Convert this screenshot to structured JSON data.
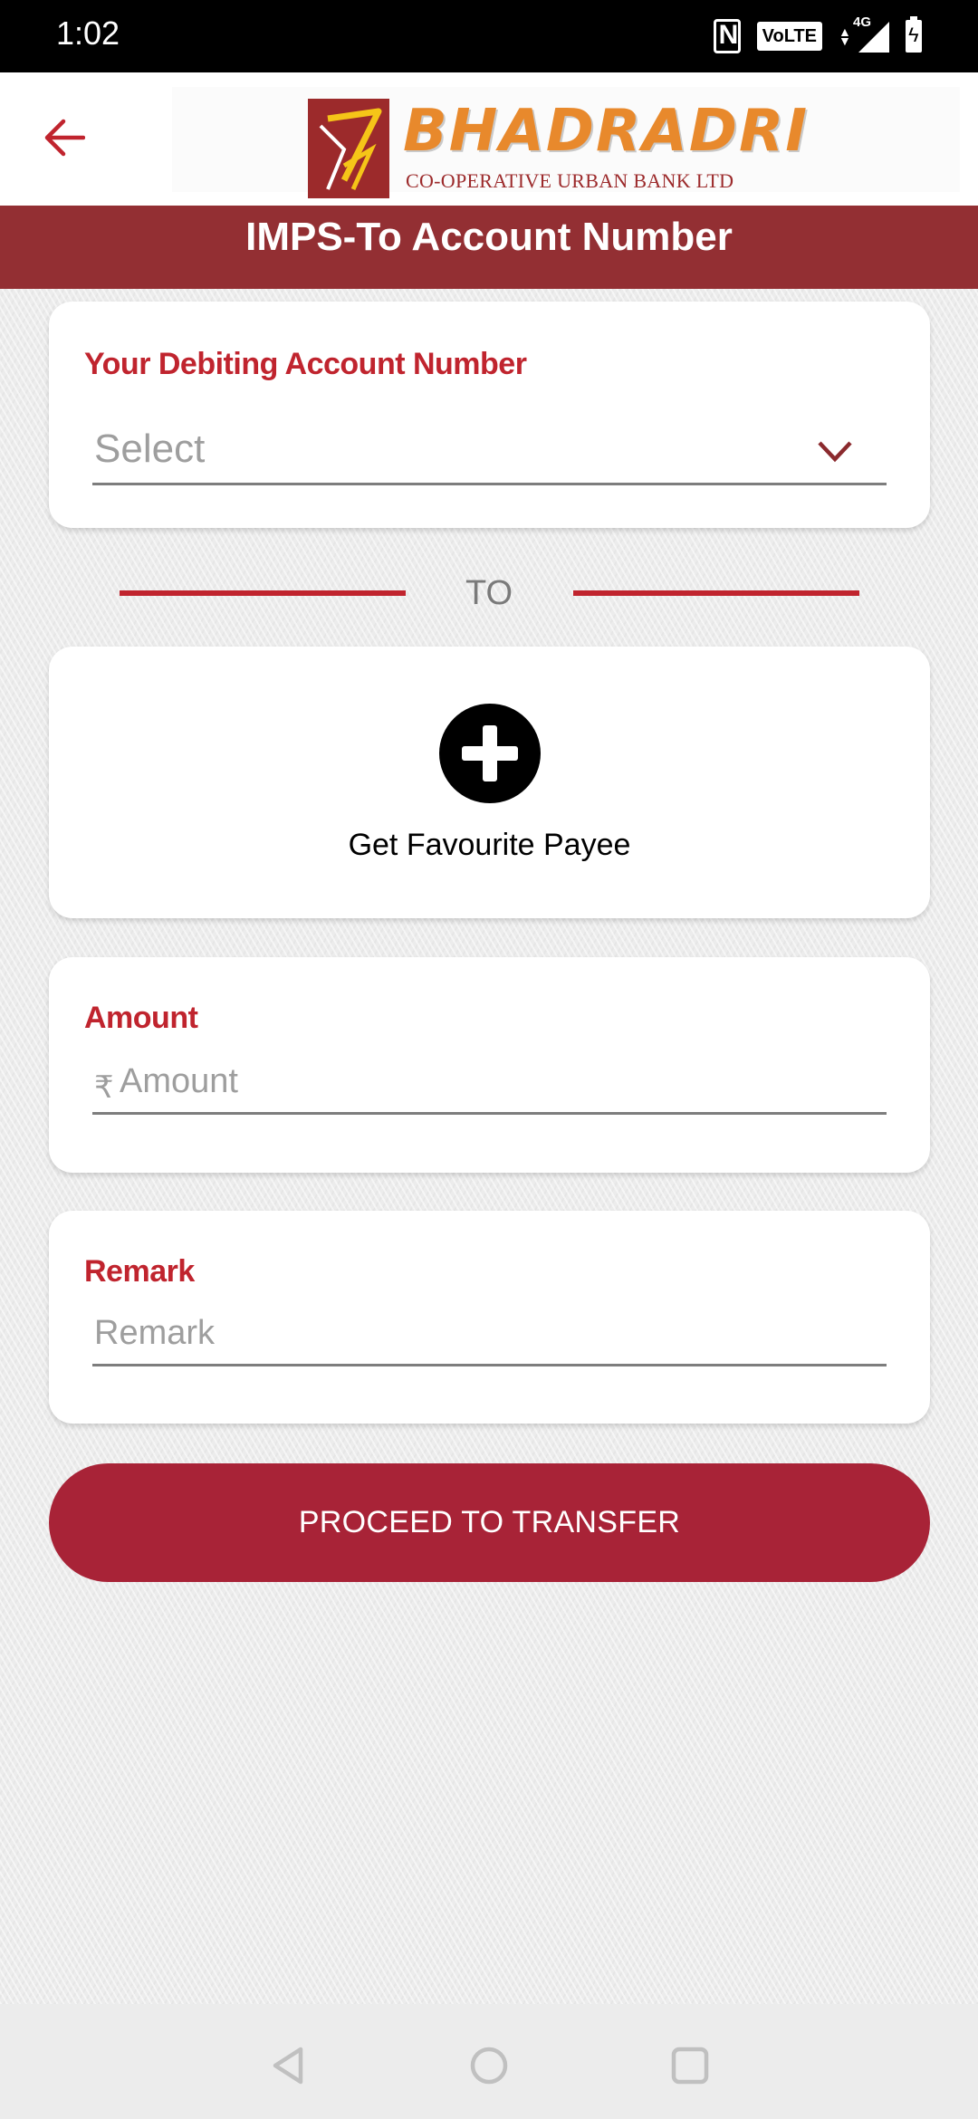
{
  "status_bar": {
    "time": "1:02",
    "icons": [
      "nfc-icon",
      "volte-icon",
      "signal-4g-icon",
      "battery-charging-icon"
    ],
    "volte_label": "VoLTE",
    "network_label": "4G"
  },
  "app_bar": {
    "back_icon": "arrow-left-icon",
    "logo_title": "BHADRADRI",
    "logo_subtitle": "CO-OPERATIVE URBAN BANK LTD"
  },
  "page": {
    "title": "IMPS-To Account Number"
  },
  "debit_account": {
    "label": "Your Debiting Account Number",
    "selected": "Select",
    "icon": "chevron-down-icon"
  },
  "separator": {
    "label": "TO"
  },
  "favourite_payee": {
    "icon": "plus-circle-icon",
    "label": "Get Favourite Payee"
  },
  "amount": {
    "label": "Amount",
    "currency_symbol": "₹",
    "placeholder": "Amount",
    "value": ""
  },
  "remark": {
    "label": "Remark",
    "placeholder": "Remark",
    "value": ""
  },
  "actions": {
    "proceed_label": "PROCEED TO TRANSFER"
  },
  "colors": {
    "brand_maroon": "#932f33",
    "label_red": "#c0242e",
    "button_red": "#a82337",
    "logo_orange": "#e8892c"
  },
  "nav_bar": {
    "buttons": [
      "back-nav-icon",
      "home-nav-icon",
      "recents-nav-icon"
    ]
  }
}
